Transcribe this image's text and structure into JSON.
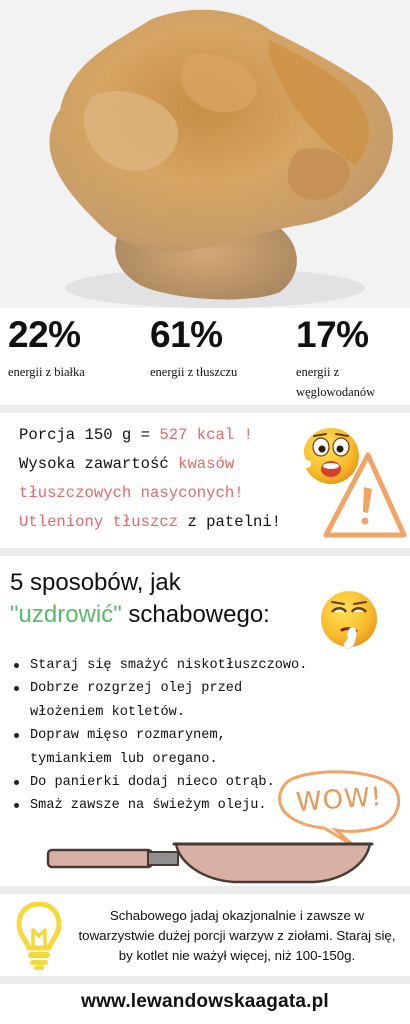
{
  "stats": [
    {
      "percent": "22%",
      "label_lines": [
        "energii z białka"
      ]
    },
    {
      "percent": "61%",
      "label_lines": [
        "energii z tłuszczu"
      ]
    },
    {
      "percent": "17%",
      "label_lines": [
        "energii z",
        "węglowodanów"
      ]
    }
  ],
  "warning": {
    "line1_prefix": "Porcja 150 g = ",
    "line1_highlight": "527 kcal !",
    "line2_prefix": "Wysoka zawartość ",
    "line2_highlight": "kwasów",
    "line3_highlight": "tłuszczowych nasyconych!",
    "line4_highlight": "Utleniony tłuszcz",
    "line4_suffix": " z patelni!"
  },
  "tips": {
    "title_line1": "5 sposobów, jak",
    "title_highlight": "\"uzdrowić\"",
    "title_suffix": " schabowego:",
    "items": [
      "Staraj się smażyć niskotłuszczowo.",
      "Dobrze rozgrzej olej przed włożeniem kotletów.",
      "Dopraw mięso rozmarynem, tymiankiem lub oregano.",
      "Do panierki dodaj nieco otrąb.",
      "Smaż zawsze na świeżym oleju."
    ],
    "wow_bubble": "WOW!"
  },
  "bottom_tip": {
    "text": "Schabowego jadaj okazjonalnie i zawsze w towarzystwie dużej porcji warzyw z ziołami. Staraj się, by kotlet nie ważył więcej, niż 100-150g."
  },
  "footer": {
    "url": "www.lewandowskaagata.pl"
  },
  "icons": {
    "hero": "breaded-cutlet-photo",
    "warning": "warning-triangle-icon",
    "emoji_shocked": "shocked-emoji-icon",
    "emoji_thinking": "thinking-emoji-icon",
    "pan": "frying-pan-icon",
    "bulb": "lightbulb-icon"
  },
  "colors": {
    "accent_red": "#e46a67",
    "accent_green": "#5db86c",
    "accent_orange": "#f2a366",
    "bulb_yellow": "#f5d83a"
  }
}
